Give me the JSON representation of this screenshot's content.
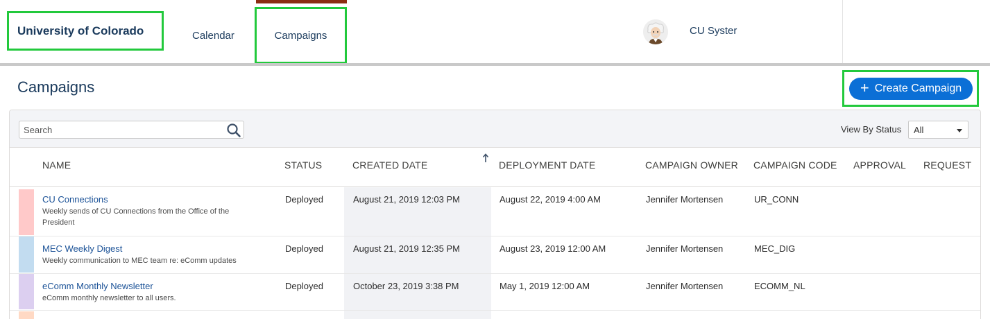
{
  "nav": {
    "brand": "University of Colorado",
    "items": [
      "Calendar",
      "Campaigns"
    ],
    "user_name": "CU Syster"
  },
  "page": {
    "title": "Campaigns",
    "create_button": "Create Campaign"
  },
  "toolbar": {
    "search_placeholder": "Search",
    "status_label": "View By Status",
    "status_value": "All"
  },
  "table": {
    "columns": [
      "NAME",
      "STATUS",
      "CREATED DATE",
      "DEPLOYMENT DATE",
      "CAMPAIGN OWNER",
      "CAMPAIGN CODE",
      "APPROVAL",
      "REQUEST"
    ],
    "rows": [
      {
        "color": "#ffc9c9",
        "name": "CU Connections",
        "description": "Weekly sends of CU Connections from the Office of the President",
        "status": "Deployed",
        "created": "August 21, 2019 12:03 PM",
        "deployment": "August 22, 2019 4:00 AM",
        "owner": "Jennifer Mortensen",
        "code": "UR_CONN"
      },
      {
        "color": "#c2dcf0",
        "name": "MEC Weekly Digest",
        "description": "Weekly communication to MEC team re: eComm updates",
        "status": "Deployed",
        "created": "August 21, 2019 12:35 PM",
        "deployment": "August 23, 2019 12:00 AM",
        "owner": "Jennifer Mortensen",
        "code": "MEC_DIG"
      },
      {
        "color": "#dccff0",
        "name": "eComm Monthly Newsletter",
        "description": "eComm monthly newsletter to all users.",
        "status": "Deployed",
        "created": "October 23, 2019 3:38 PM",
        "deployment": "May 1, 2019 12:00 AM",
        "owner": "Jennifer Mortensen",
        "code": "ECOMM_NL"
      }
    ],
    "next_row_color": "#ffd9c4"
  }
}
